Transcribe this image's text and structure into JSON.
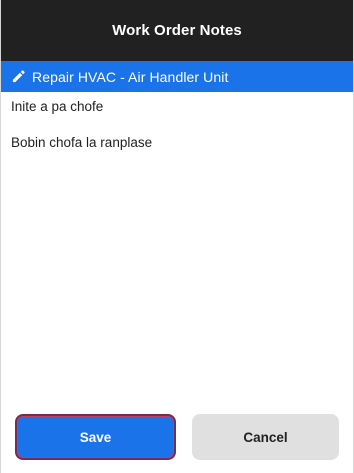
{
  "header": {
    "title": "Work Order Notes"
  },
  "work_order": {
    "title": "Repair HVAC - Air Handler Unit",
    "icon": "pencil-icon"
  },
  "notes": {
    "lines": [
      "Inite a pa chofe",
      "Bobin chofa la ranplase"
    ]
  },
  "actions": {
    "save_label": "Save",
    "cancel_label": "Cancel"
  },
  "colors": {
    "header_bg": "#212121",
    "accent": "#1a73e8",
    "cancel_bg": "#e0e0e0"
  }
}
